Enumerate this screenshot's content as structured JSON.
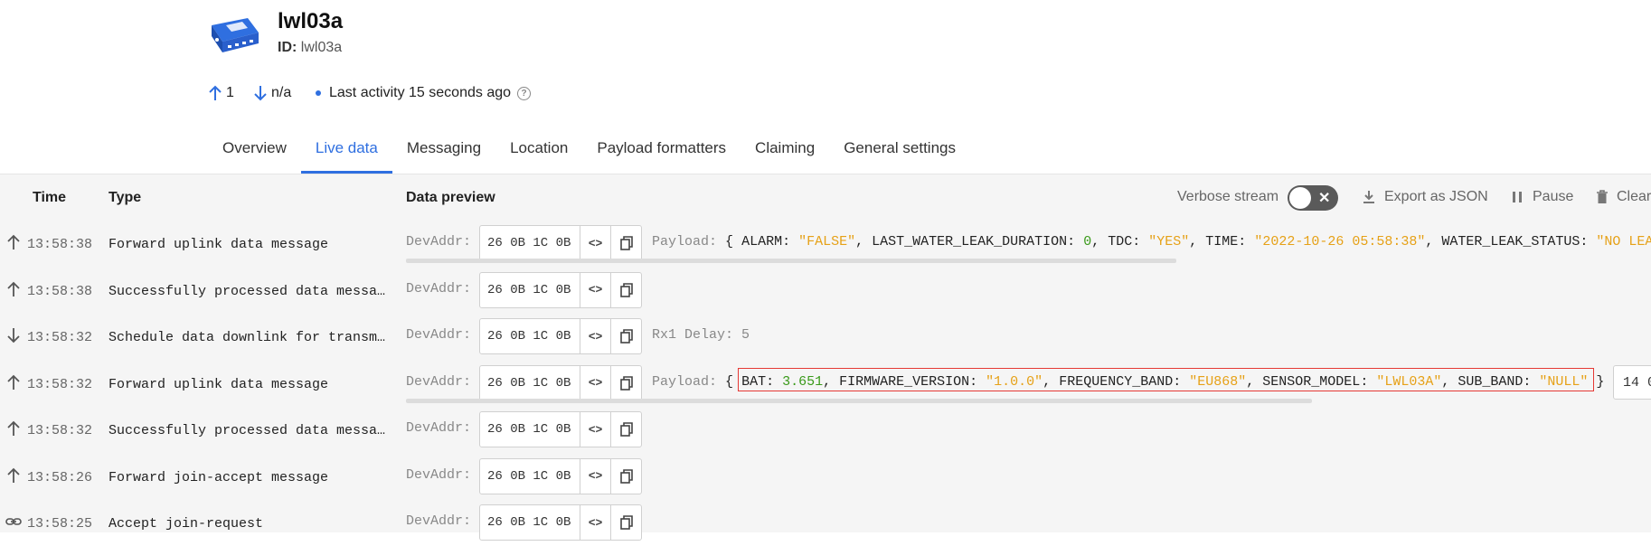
{
  "device": {
    "title": "lwl03a",
    "id_label": "ID:",
    "id_value": "lwl03a",
    "uplink_count": "1",
    "downlink_count": "n/a",
    "last_activity": "Last activity 15 seconds ago"
  },
  "tabs": [
    "Overview",
    "Live data",
    "Messaging",
    "Location",
    "Payload formatters",
    "Claiming",
    "General settings"
  ],
  "active_tab": "Live data",
  "table": {
    "col_time": "Time",
    "col_type": "Type",
    "col_preview": "Data preview",
    "verbose_label": "Verbose stream",
    "export_label": "Export as JSON",
    "pause_label": "Pause",
    "clear_label": "Clear"
  },
  "rows": [
    {
      "dir": "up",
      "time": "13:58:38",
      "type": "Forward uplink data message",
      "devaddr_label": "DevAddr:",
      "devaddr": "26 0B 1C 0B",
      "payload_label": "Payload:",
      "payload_pairs": [
        {
          "k": "ALARM",
          "v": "\"FALSE\"",
          "t": "s"
        },
        {
          "k": "LAST_WATER_LEAK_DURATION",
          "v": "0",
          "t": "n"
        },
        {
          "k": "TDC",
          "v": "\"YES\"",
          "t": "s"
        },
        {
          "k": "TIME",
          "v": "\"2022-10-26 05:58:38\"",
          "t": "s"
        },
        {
          "k": "WATER_LEAK_STATUS",
          "v": "\"NO LEA",
          "t": "s"
        }
      ]
    },
    {
      "dir": "up",
      "time": "13:58:38",
      "type": "Successfully processed data messa…",
      "devaddr_label": "DevAddr:",
      "devaddr": "26 0B 1C 0B"
    },
    {
      "dir": "down",
      "time": "13:58:32",
      "type": "Schedule data downlink for transm…",
      "devaddr_label": "DevAddr:",
      "devaddr": "26 0B 1C 0B",
      "extra": "Rx1 Delay: 5"
    },
    {
      "dir": "up",
      "time": "13:58:32",
      "type": "Forward uplink data message",
      "devaddr_label": "DevAddr:",
      "devaddr": "26 0B 1C 0B",
      "payload_label": "Payload:",
      "payload_pairs": [
        {
          "k": "BAT",
          "v": "3.651",
          "t": "n"
        },
        {
          "k": "FIRMWARE_VERSION",
          "v": "\"1.0.0\"",
          "t": "s"
        },
        {
          "k": "FREQUENCY_BAND",
          "v": "\"EU868\"",
          "t": "s"
        },
        {
          "k": "SENSOR_MODEL",
          "v": "\"LWL03A\"",
          "t": "s"
        },
        {
          "k": "SUB_BAND",
          "v": "\"NULL\"",
          "t": "s"
        }
      ],
      "trailing_box": "14 0"
    },
    {
      "dir": "up",
      "time": "13:58:32",
      "type": "Successfully processed data messa…",
      "devaddr_label": "DevAddr:",
      "devaddr": "26 0B 1C 0B"
    },
    {
      "dir": "up",
      "time": "13:58:26",
      "type": "Forward join-accept message",
      "devaddr_label": "DevAddr:",
      "devaddr": "26 0B 1C 0B"
    },
    {
      "dir": "link",
      "time": "13:58:25",
      "type": "Accept join-request",
      "devaddr_label": "DevAddr:",
      "devaddr": "26 0B 1C 0B"
    }
  ]
}
